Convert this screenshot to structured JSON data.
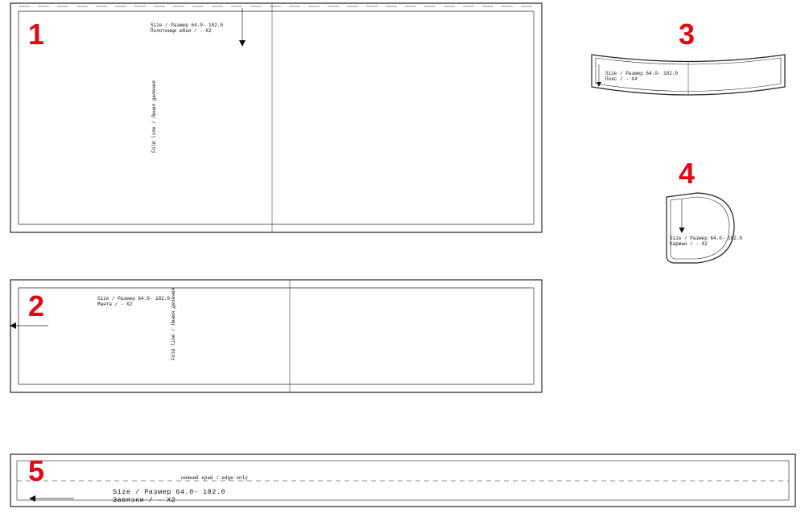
{
  "numbers": {
    "p1": "1",
    "p2": "2",
    "p3": "3",
    "p4": "4",
    "p5": "5"
  },
  "piece1": {
    "size_line": "Size / Размер   64.0- 182.0",
    "name_line": "Полотнище юбки /   - X2",
    "fold": "Fold line / Линия деления"
  },
  "piece2": {
    "size_line": "Size / Размер   64.0- 182.0",
    "name_line": "Манта /   - X2",
    "fold": "Fold line / Линия деления"
  },
  "piece3": {
    "size_line": "Size / Размер   64.0- 182.0",
    "name_line": "Пояс /   - X4"
  },
  "piece4": {
    "size_line": "Size / Размер   64.0- 182.0",
    "name_line": "Карман /   - X2"
  },
  "piece5": {
    "size_line": "Size / Размер   64.0- 182.0",
    "name_line": "Завязки /   - X2",
    "center": "нижний край / edge only"
  }
}
